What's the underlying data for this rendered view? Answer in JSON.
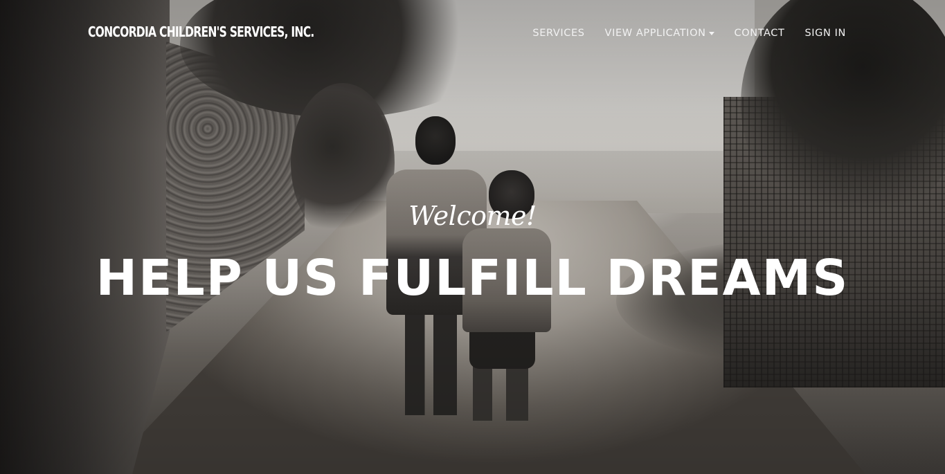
{
  "brand": {
    "name": "CONCORDIA CHILDREN'S SERVICES, INC."
  },
  "nav": {
    "items": [
      {
        "label": "SERVICES"
      },
      {
        "label": "VIEW APPLICATION",
        "icon": "caret-down-icon"
      },
      {
        "label": "CONTACT"
      },
      {
        "label": "SIGN IN"
      }
    ]
  },
  "hero": {
    "welcome": "Welcome!",
    "headline": "HELP US FULFILL DREAMS"
  },
  "colors": {
    "text": "#ffffff",
    "nav_text": "#f2f2f2"
  }
}
